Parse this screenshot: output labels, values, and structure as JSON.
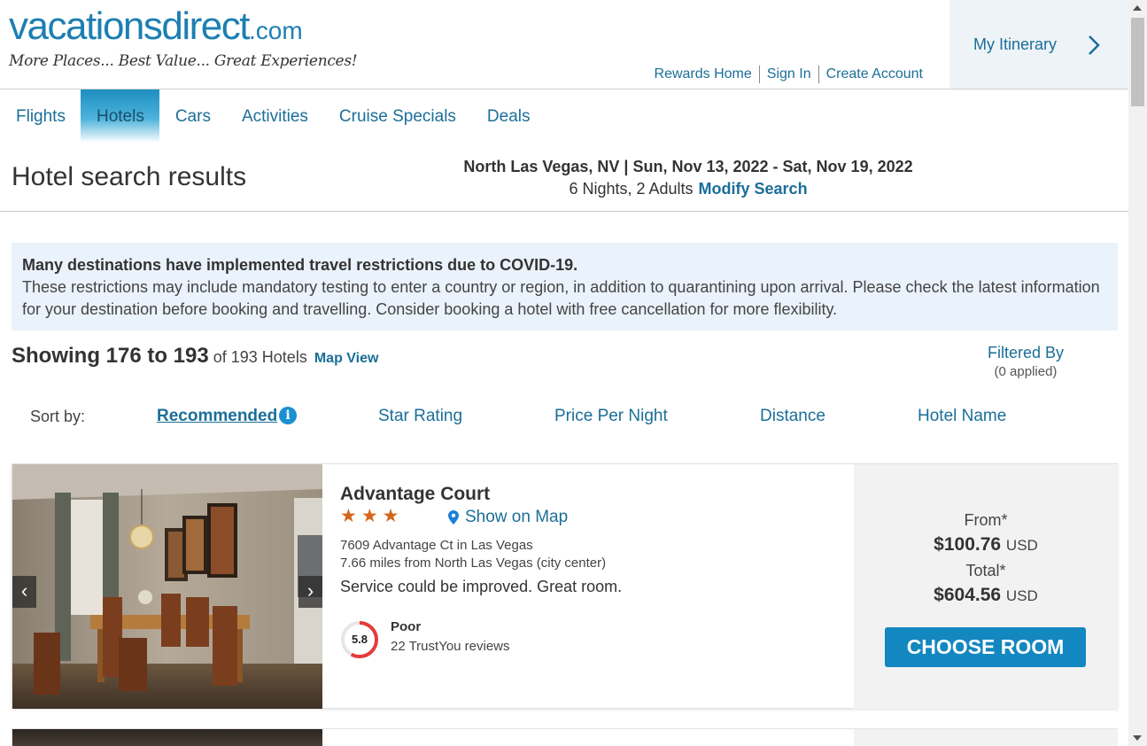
{
  "header": {
    "logo_main": "vacationsdirect",
    "logo_dotcom": ".com",
    "logo_tagline": "More Places... Best Value... Great Experiences!",
    "links": [
      "Rewards Home",
      "Sign In",
      "Create Account"
    ],
    "itinerary_label": "My Itinerary"
  },
  "nav": {
    "tabs": [
      "Flights",
      "Hotels",
      "Cars",
      "Activities",
      "Cruise Specials",
      "Deals"
    ],
    "active": "Hotels"
  },
  "search": {
    "page_title": "Hotel search results",
    "location_dates": "North Las Vegas, NV | Sun, Nov 13, 2022 - Sat, Nov 19, 2022",
    "guests": "6 Nights, 2 Adults",
    "modify_label": "Modify Search"
  },
  "notice": {
    "title": "Many destinations have implemented travel restrictions due to COVID-19.",
    "body": "These restrictions may include mandatory testing to enter a country or region, in addition to quarantining upon arrival. Please check the latest information for your destination before booking and travelling. Consider booking a hotel with free cancellation for more flexibility."
  },
  "results": {
    "showing_bold": "Showing 176 to 193",
    "showing_rest": "of 193 Hotels",
    "map_view_label": "Map View",
    "filtered_label": "Filtered By",
    "filtered_count": "(0 applied)"
  },
  "sort": {
    "label": "Sort by:",
    "options": [
      "Recommended",
      "Star Rating",
      "Price Per Night",
      "Distance",
      "Hotel Name"
    ],
    "active": "Recommended",
    "info_glyph": "i"
  },
  "hotel": {
    "name": "Advantage Court",
    "stars": 3,
    "stars_glyphs": "★★★",
    "show_map_label": "Show on Map",
    "address": "7609 Advantage Ct in Las Vegas",
    "distance": "7.66 miles from North Las Vegas (city center)",
    "review_summary": "Service could be improved. Great room.",
    "score": "5.8",
    "score_fraction": 0.58,
    "rating_word": "Poor",
    "review_count": "22 TrustYou reviews",
    "from_label": "From*",
    "from_price": "$100.76",
    "total_label": "Total*",
    "total_price": "$604.56",
    "currency": "USD",
    "choose_label": "CHOOSE ROOM",
    "prev_glyph": "‹",
    "next_glyph": "›"
  },
  "colors": {
    "brand_blue": "#1c7fb2",
    "link_blue": "#1b6e98",
    "button_blue": "#1287c0",
    "star_orange": "#d4661c",
    "score_red": "#e53b3b"
  },
  "icons": [
    "chevron-right-icon",
    "info-icon",
    "map-pin-icon",
    "star-icon",
    "chevron-left-icon"
  ]
}
